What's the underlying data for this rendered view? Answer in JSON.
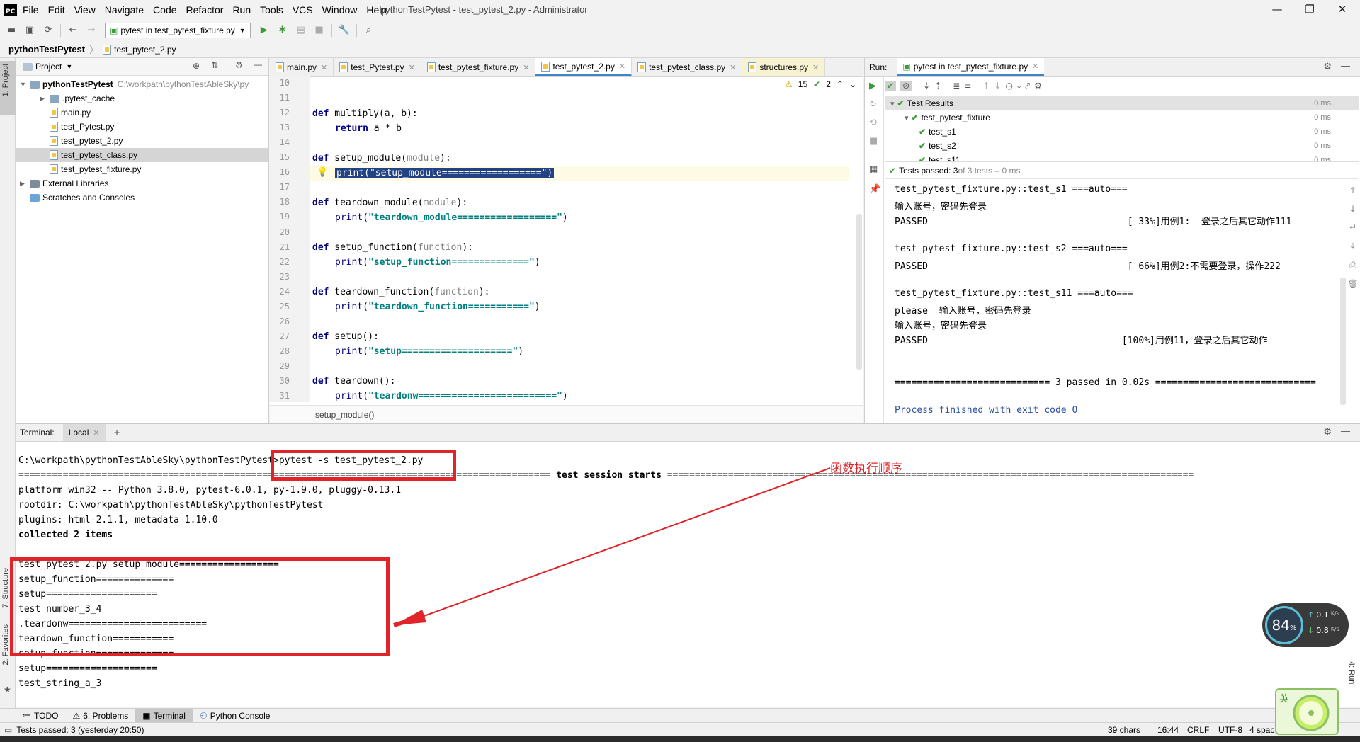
{
  "window": {
    "app_logo": "PC",
    "title": "pythonTestPytest - test_pytest_2.py - Administrator",
    "menu": [
      "File",
      "Edit",
      "View",
      "Navigate",
      "Code",
      "Refactor",
      "Run",
      "Tools",
      "VCS",
      "Window",
      "Help"
    ]
  },
  "toolbar": {
    "run_config": "pytest in test_pytest_fixture.py"
  },
  "breadcrumb": {
    "project": "pythonTestPytest",
    "file": "test_pytest_2.py"
  },
  "leftstrip": {
    "project_tab": "1: Project",
    "structure_tab": "7: Structure",
    "favorites_tab": "2: Favorites"
  },
  "project_panel": {
    "title": "Project",
    "tree": [
      {
        "label": "pythonTestPytest",
        "extra": "C:\\workpath\\pythonTestAbleSky\\py",
        "kind": "root",
        "level": 0
      },
      {
        "label": ".pytest_cache",
        "kind": "folder",
        "level": 1
      },
      {
        "label": "main.py",
        "kind": "py",
        "level": 1
      },
      {
        "label": "test_Pytest.py",
        "kind": "py",
        "level": 1
      },
      {
        "label": "test_pytest_2.py",
        "kind": "py",
        "level": 1
      },
      {
        "label": "test_pytest_class.py",
        "kind": "py",
        "level": 1,
        "selected": true
      },
      {
        "label": "test_pytest_fixture.py",
        "kind": "py",
        "level": 1
      },
      {
        "label": "External Libraries",
        "kind": "lib",
        "level": 0
      },
      {
        "label": "Scratches and Consoles",
        "kind": "scratch",
        "level": 0
      }
    ]
  },
  "editor": {
    "tabs": [
      {
        "label": "main.py",
        "active": false,
        "yellow": false
      },
      {
        "label": "test_Pytest.py",
        "active": false,
        "yellow": false
      },
      {
        "label": "test_pytest_fixture.py",
        "active": false,
        "yellow": false
      },
      {
        "label": "test_pytest_2.py",
        "active": true,
        "yellow": false
      },
      {
        "label": "test_pytest_class.py",
        "active": false,
        "yellow": false
      },
      {
        "label": "structures.py",
        "active": false,
        "yellow": true
      }
    ],
    "inspections": {
      "warnings": "15",
      "ok": "2"
    },
    "line_numbers": [
      "10",
      "11",
      "12",
      "13",
      "14",
      "15",
      "16",
      "17",
      "18",
      "19",
      "20",
      "21",
      "22",
      "23",
      "24",
      "25",
      "26",
      "27",
      "28",
      "29",
      "30",
      "31"
    ],
    "code": {
      "l12": {
        "kw": "def",
        "name": " multiply(a, b):"
      },
      "l13": {
        "kw": "return",
        "rest": " a * b"
      },
      "l15": {
        "kw": "def",
        "name": " setup_module(",
        "param": "module",
        "tail": "):"
      },
      "l16": {
        "fn": "print(",
        "str": "\"setup_module==================\"",
        "tail": ")"
      },
      "l18": {
        "kw": "def",
        "name": " teardown_module(",
        "param": "module",
        "tail": "):"
      },
      "l19": {
        "fn": "print(",
        "str": "\"teardown_module==================\"",
        "tail": ")"
      },
      "l21": {
        "kw": "def",
        "name": " setup_function(",
        "param": "function",
        "tail": "):"
      },
      "l22": {
        "fn": "print(",
        "str": "\"setup_function==============\"",
        "tail": ")"
      },
      "l24": {
        "kw": "def",
        "name": " teardown_function(",
        "param": "function",
        "tail": "):"
      },
      "l25": {
        "fn": "print(",
        "str": "\"teardown_function===========\"",
        "tail": ")"
      },
      "l27": {
        "kw": "def",
        "name": " setup():"
      },
      "l28": {
        "fn": "print(",
        "str": "\"setup====================\"",
        "tail": ")"
      },
      "l30": {
        "kw": "def",
        "name": " teardown():"
      },
      "l31": {
        "fn": "print(",
        "str": "\"teardonw=========================\"",
        "tail": ")"
      }
    },
    "crumb": "setup_module()"
  },
  "run_panel": {
    "label": "Run:",
    "tab": "pytest in test_pytest_fixture.py",
    "tree": [
      {
        "label": "Test Results",
        "time": "0 ms",
        "level": 0
      },
      {
        "label": "test_pytest_fixture",
        "time": "0 ms",
        "level": 1
      },
      {
        "label": "test_s1",
        "time": "0 ms",
        "level": 2
      },
      {
        "label": "test_s2",
        "time": "0 ms",
        "level": 2
      },
      {
        "label": "test_s11",
        "time": "0 ms",
        "level": 2
      }
    ],
    "status_bold": "Tests passed: 3",
    "status_rest": " of 3 tests – 0 ms",
    "output": [
      "test_pytest_fixture.py::test_s1 ===auto===",
      "输入账号，密码先登录",
      "PASSED                                    [ 33%]用例1:  登录之后其它动作111",
      "",
      "test_pytest_fixture.py::test_s2 ===auto===",
      "PASSED                                    [ 66%]用例2:不需要登录，操作222",
      "",
      "test_pytest_fixture.py::test_s11 ===auto===",
      "please  输入账号，密码先登录",
      "输入账号，密码先登录",
      "PASSED                                   [100%]用例11，登录之后其它动作",
      "",
      "",
      "============================ 3 passed in 0.02s ============================="
    ],
    "exit_line": "Process finished with exit code 0"
  },
  "terminal": {
    "label": "Terminal:",
    "tab": "Local",
    "lines": [
      "C:\\workpath\\pythonTestAbleSky\\pythonTestPytest>pytest -s test_pytest_2.py",
      "================================================================================================ test session starts ===============================================================================================",
      "platform win32 -- Python 3.8.0, pytest-6.0.1, py-1.9.0, pluggy-0.13.1",
      "rootdir: C:\\workpath\\pythonTestAbleSky\\pythonTestPytest",
      "plugins: html-2.1.1, metadata-1.10.0",
      "collected 2 items",
      "",
      "test_pytest_2.py setup_module==================",
      "setup_function==============",
      "setup====================",
      "test number_3_4",
      ".teardonw=========================",
      "teardown_function===========",
      "setup_function==============",
      "setup====================",
      "test_string_a_3"
    ],
    "annotation": "函数执行顺序"
  },
  "bottom_tools": [
    {
      "label": "TODO",
      "active": false
    },
    {
      "label": "6: Problems",
      "active": false
    },
    {
      "label": "Terminal",
      "active": true
    },
    {
      "label": "Python Console",
      "active": false
    }
  ],
  "right_strip": {
    "run_tab": "4: Run"
  },
  "status": {
    "left": "Tests passed: 3 (yesterday 20:50)",
    "chars": "39 chars",
    "pos": "16:44",
    "eol": "CRLF",
    "enc": "UTF-8",
    "indent": "4 spac"
  },
  "net_widget": {
    "percent": "84",
    "unit": "%",
    "up": "0.1",
    "down": "0.8",
    "rate_unit": "K/s"
  },
  "lemon_widget": {
    "char": "英"
  },
  "colors": {
    "accent": "#4083c9",
    "annotation_red": "#e0242a",
    "pass_green": "#3e9a38",
    "selection": "#214283"
  }
}
